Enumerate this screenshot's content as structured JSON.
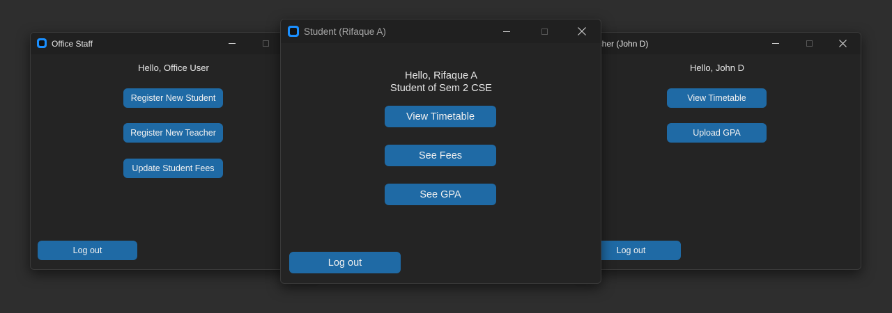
{
  "office": {
    "title": "Office Staff",
    "greeting": "Hello, Office User",
    "buttons": [
      "Register New Student",
      "Register New Teacher",
      "Update Student Fees"
    ],
    "logout_label": "Log out"
  },
  "student": {
    "title": "Student (Rifaque A)",
    "greeting": "Hello, Rifaque A\nStudent of Sem 2 CSE",
    "buttons": [
      "View Timetable",
      "See Fees",
      "See GPA"
    ],
    "logout_label": "Log out"
  },
  "teacher": {
    "title_visible": "acher (John D)",
    "greeting": "Hello, John D",
    "buttons": [
      "View Timetable",
      "Upload GPA"
    ],
    "logout_label": "Log out"
  },
  "colors": {
    "button_bg": "#1f6aa5",
    "window_bg": "#242424",
    "titlebar_bg": "#202020",
    "desktop_bg": "#2e2e2e",
    "app_icon": "#1a8fff"
  },
  "icons": {
    "app": "app-window-icon",
    "minimize": "minimize-icon",
    "maximize": "maximize-icon",
    "close": "close-icon"
  }
}
